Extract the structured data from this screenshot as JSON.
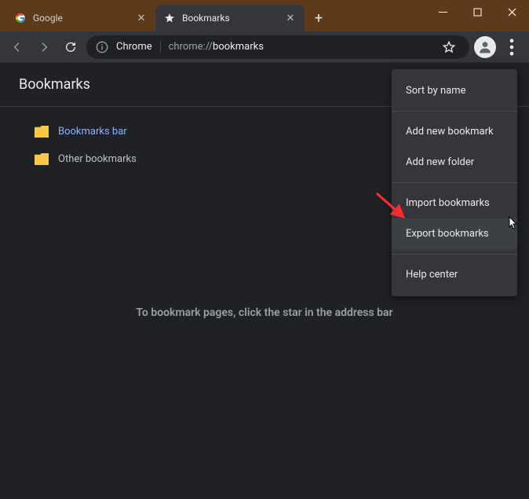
{
  "titlebar": {
    "tabs": [
      {
        "title": "Google",
        "active": false
      },
      {
        "title": "Bookmarks",
        "active": true
      }
    ],
    "newtab_glyph": "+"
  },
  "toolbar": {
    "scheme_label": "Chrome",
    "url_dim": "chrome://",
    "url_hl": "bookmarks"
  },
  "page": {
    "title": "Bookmarks",
    "folders": [
      {
        "label": "Bookmarks bar",
        "selected": true
      },
      {
        "label": "Other bookmarks",
        "selected": false
      }
    ],
    "empty_hint": "To bookmark pages, click the star in the address bar"
  },
  "menu": {
    "groups": [
      [
        {
          "label": "Sort by name"
        }
      ],
      [
        {
          "label": "Add new bookmark"
        },
        {
          "label": "Add new folder"
        }
      ],
      [
        {
          "label": "Import bookmarks"
        },
        {
          "label": "Export bookmarks",
          "hover": true
        }
      ],
      [
        {
          "label": "Help center"
        }
      ]
    ]
  }
}
